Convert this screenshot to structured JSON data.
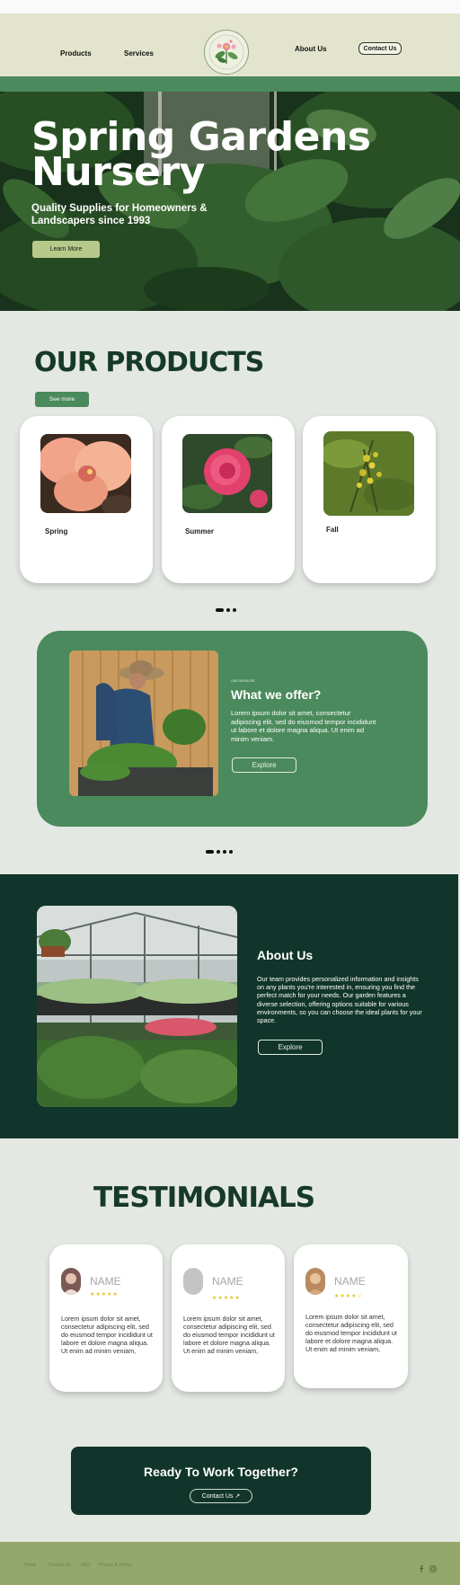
{
  "header": {
    "nav_left": [
      "Products",
      "Services"
    ],
    "nav_right": "About Us",
    "contact_button": "Contact Us"
  },
  "hero": {
    "title_line1": "Spring Gardens",
    "title_line2": "Nursery",
    "subtitle": "Quality Supplies for Homeowners & Landscapers since 1993",
    "button": "Learn More"
  },
  "products": {
    "title": "OUR PRODUCTS",
    "see_more": "See more",
    "items": [
      {
        "label": "Spring"
      },
      {
        "label": "Summer"
      },
      {
        "label": "Fall"
      }
    ]
  },
  "offer": {
    "tiny_label": "OUR SERVICES",
    "title": "What we offer?",
    "text": "Lorem ipsum dolor sit amet, consectetur adipiscing elit, sed do eiusmod tempor incididunt ut labore et dolore magna aliqua. Ut enim ad minim veniam.",
    "button": "Explore"
  },
  "about": {
    "title": "About Us",
    "text": "Our team provides personalized information and insights on any plants you're interested in, ensuring you find the perfect match for your needs. Our garden features a diverse selection, offering options suitable for various environments, so you can choose the ideal plants for your space.",
    "button": "Explore"
  },
  "testimonials": {
    "title": "TESTIMONIALS",
    "items": [
      {
        "name": "NAME",
        "stars": "★★★★★",
        "text": "Lorem ipsum dolor sit amet, consectetur adipiscing elit, sed do eiusmod tempor incididunt ut labore et dolore magna aliqua. Ut enim ad minim veniam,"
      },
      {
        "name": "NAME",
        "stars": "★★★★★",
        "text": "Lorem ipsum dolor sit amet, consectetur adipiscing elit, sed do eiusmod tempor incididunt ut labore et dolore magna aliqua. Ut enim ad minim veniam,"
      },
      {
        "name": "NAME",
        "stars": "★★★★☆",
        "text": "Lorem ipsum dolor sit amet, consectetur adipiscing elit, sed do eiusmod tempor incididunt ut labore et dolore magna aliqua. Ut enim ad minim veniam,"
      }
    ]
  },
  "cta": {
    "title": "Ready To Work Together?",
    "button": "Contact Us ↗"
  },
  "footer": {
    "links": [
      "Home",
      "Contact Us",
      "FAQ",
      "Privacy & Terms"
    ],
    "social": [
      "facebook-icon",
      "instagram-icon"
    ]
  },
  "colors": {
    "header_bg": "#e3e4cd",
    "brand_green": "#4b8a5c",
    "dark_green": "#11352a",
    "footer_bg": "#94a86b",
    "button_lime": "#b7c98a"
  }
}
